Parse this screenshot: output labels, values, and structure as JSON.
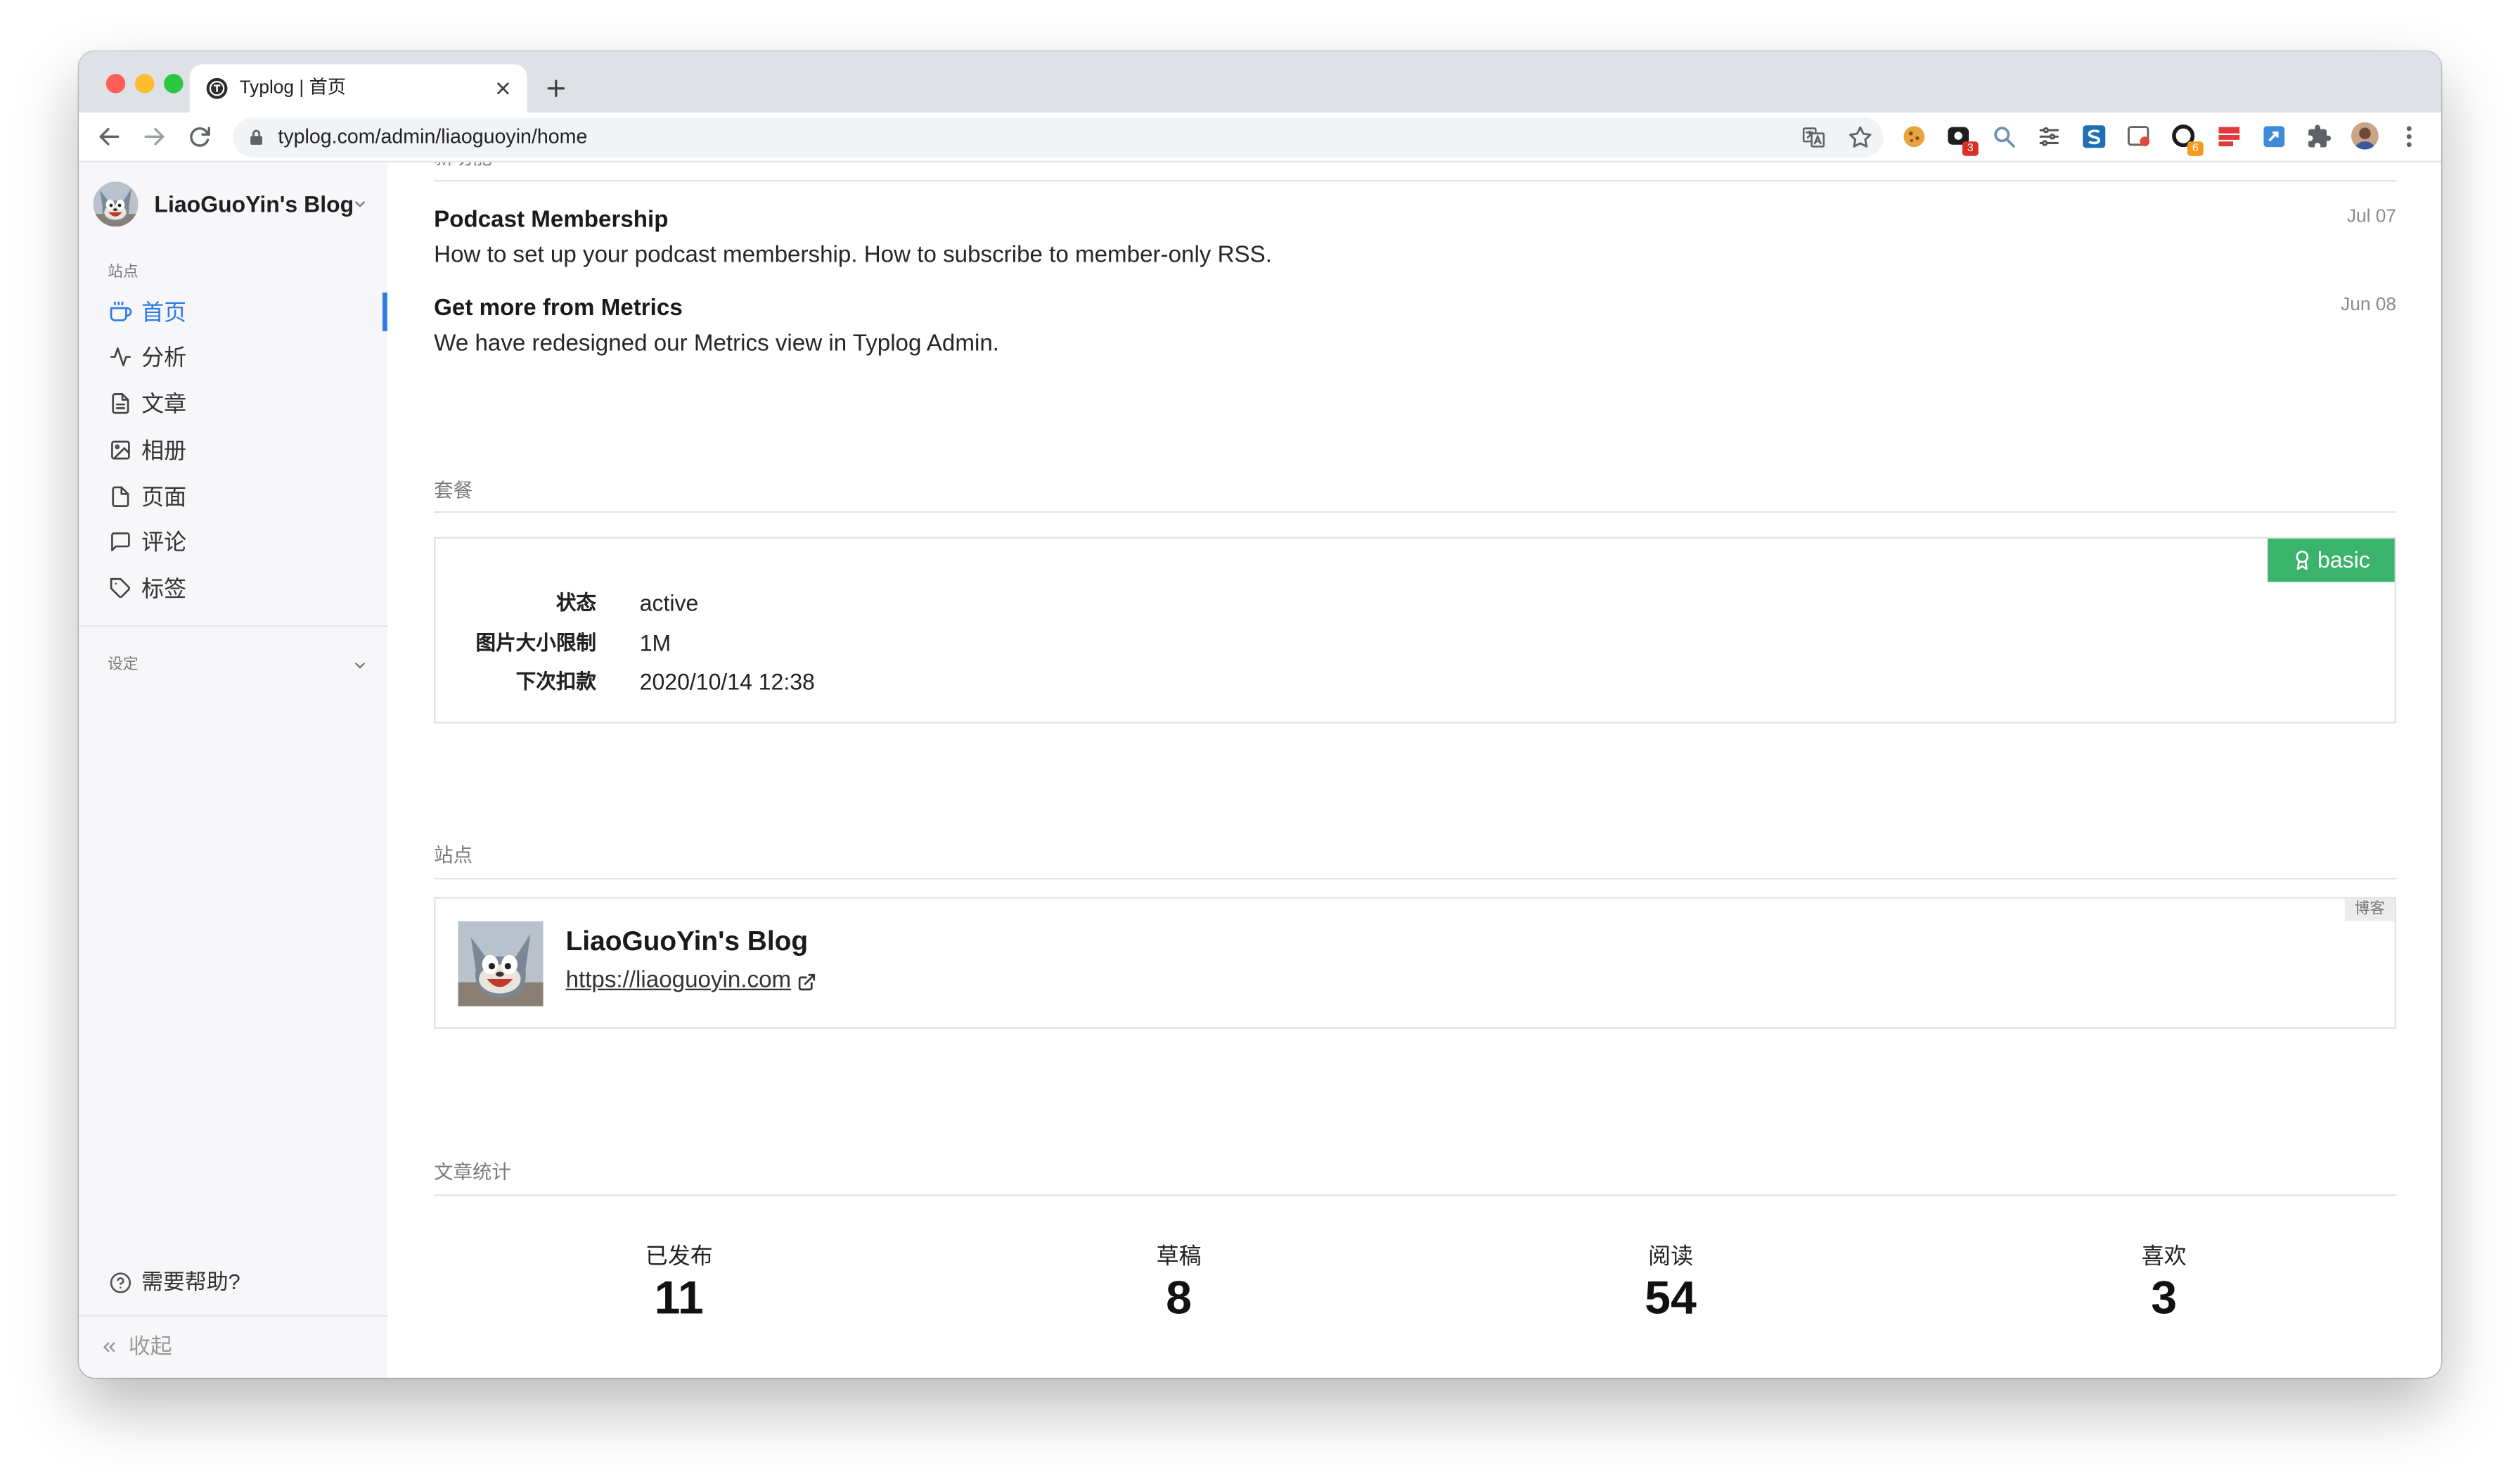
{
  "browser": {
    "tab": {
      "title": "Typlog | 首页",
      "favicon": "typlog-logo-icon"
    },
    "url": "typlog.com/admin/liaoguoyin/home",
    "extensions": [
      {
        "icon": "cookie-icon"
      },
      {
        "icon": "dark-square-extension-icon",
        "badge": "3",
        "badge_color": "#d93025"
      },
      {
        "icon": "magnifier-extension-icon"
      },
      {
        "icon": "sliders-icon"
      },
      {
        "icon": "s-logo-extension-icon"
      },
      {
        "icon": "screenshot-extension-icon"
      },
      {
        "icon": "circle-extension-icon",
        "badge": "6",
        "badge_color": "#f29b1d"
      },
      {
        "icon": "red-notes-extension-icon"
      },
      {
        "icon": "blue-extension-icon"
      },
      {
        "icon": "puzzle-icon"
      },
      {
        "icon": "profile-avatar-icon"
      },
      {
        "icon": "more-vert-icon"
      }
    ]
  },
  "sidebar": {
    "blog_name": "LiaoGuoYin's Blog",
    "section_label": "站点",
    "items": [
      {
        "label": "首页",
        "icon": "coffee-cup-icon",
        "active": true
      },
      {
        "label": "分析",
        "icon": "activity-icon"
      },
      {
        "label": "文章",
        "icon": "file-text-icon"
      },
      {
        "label": "相册",
        "icon": "image-icon"
      },
      {
        "label": "页面",
        "icon": "file-icon"
      },
      {
        "label": "评论",
        "icon": "message-icon"
      },
      {
        "label": "标签",
        "icon": "tag-icon"
      }
    ],
    "settings_label": "设定",
    "help_label": "需要帮助?",
    "collapse_label": "收起"
  },
  "main": {
    "news": {
      "title": "新功能",
      "items": [
        {
          "title": "Podcast Membership",
          "date": "Jul 07",
          "description": "How to set up your podcast membership. How to subscribe to member-only RSS."
        },
        {
          "title": "Get more from Metrics",
          "date": "Jun 08",
          "description": "We have redesigned our Metrics view in Typlog Admin."
        }
      ]
    },
    "plan": {
      "title": "套餐",
      "badge": "basic",
      "rows": [
        {
          "label": "状态",
          "value": "active"
        },
        {
          "label": "图片大小限制",
          "value": "1M"
        },
        {
          "label": "下次扣款",
          "value": "2020/10/14 12:38"
        }
      ]
    },
    "site": {
      "title": "站点",
      "name": "LiaoGuoYin's Blog",
      "url": "https://liaoguoyin.com",
      "badge": "博客"
    },
    "stats": {
      "title": "文章统计",
      "items": [
        {
          "label": "已发布",
          "value": "11"
        },
        {
          "label": "草稿",
          "value": "8"
        },
        {
          "label": "阅读",
          "value": "54"
        },
        {
          "label": "喜欢",
          "value": "3"
        }
      ]
    }
  },
  "colors": {
    "accent": "#2c7be5",
    "badge_green": "#3ab46c",
    "sidebar_bg": "#f7f7f9",
    "tabstrip_bg": "#dee1e6"
  }
}
